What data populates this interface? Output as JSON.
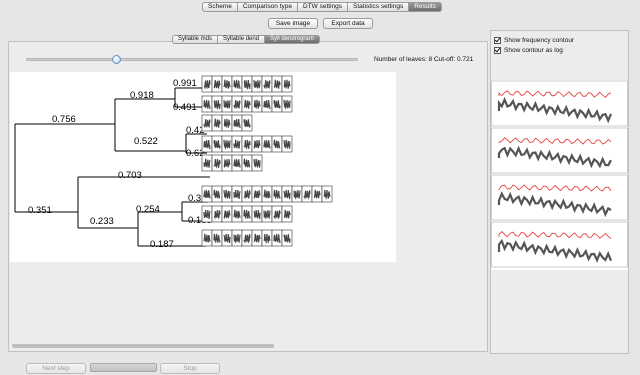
{
  "tabs": [
    "Scheme",
    "Comparison type",
    "DTW settings",
    "Statistics settings",
    "Results"
  ],
  "toolbar": {
    "save_image": "Save image",
    "export_data": "Export data"
  },
  "view_tabs": [
    "Syllable mds",
    "Syllable dend",
    "Syll dendrogram"
  ],
  "leaves_info": "Number of leaves: 8 Cut-off: 0.721",
  "slider": {
    "value_fraction": 0.27
  },
  "dendrogram": {
    "labels": [
      "0.991",
      "0.918",
      "0.491",
      "0.756",
      "0.42",
      "0.522",
      "0.62",
      "0.703",
      "0.324",
      "0.351",
      "0.254",
      "0.233",
      "0.159",
      "0.187"
    ],
    "leaf_rows": [
      9,
      9,
      5,
      9,
      6,
      13,
      9,
      9
    ]
  },
  "options": {
    "show_frequency_contour": "Show frequency contour",
    "show_contour_as_log": "Show contour as log"
  },
  "bottom": {
    "next_step": "Next step",
    "stop": "Stop"
  },
  "colors": {
    "active_tab": "#808080",
    "contour_red": "#e0302a",
    "contour_gray": "#555555"
  }
}
